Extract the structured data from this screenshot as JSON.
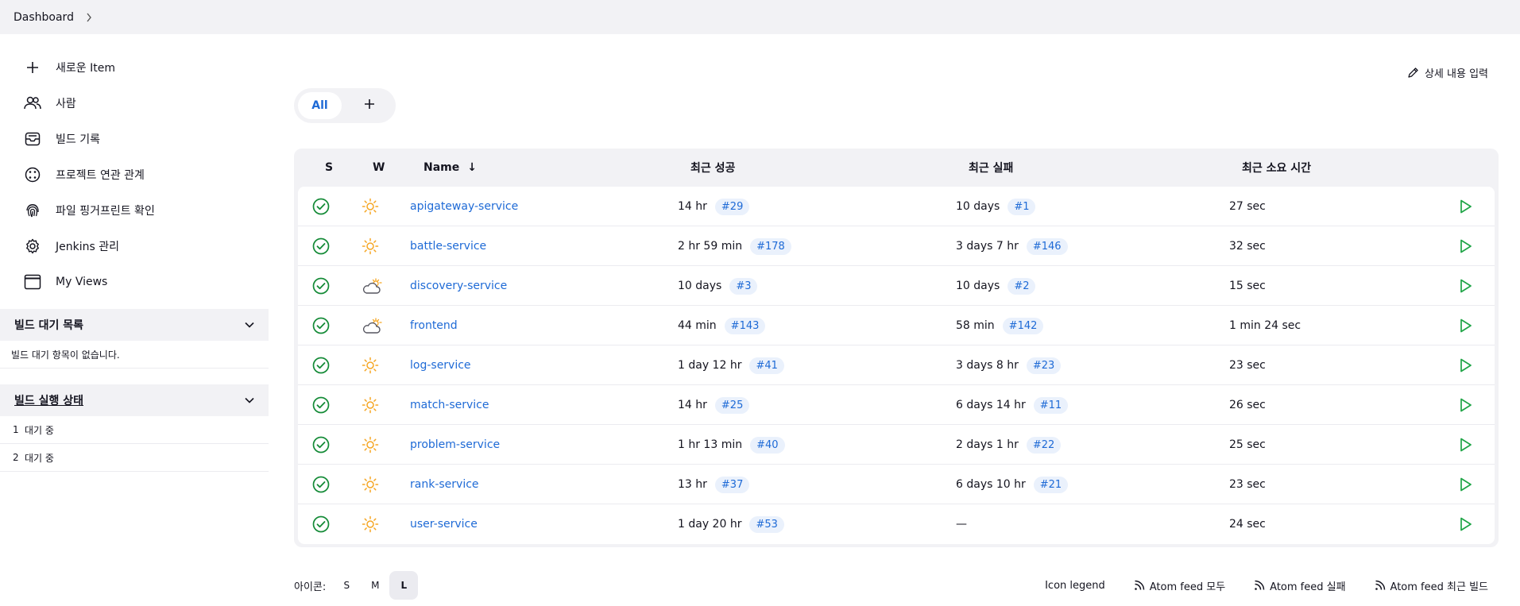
{
  "breadcrumb": {
    "root": "Dashboard"
  },
  "sidebar": {
    "items": [
      {
        "label": "새로운 Item",
        "icon": "plus-icon"
      },
      {
        "label": "사람",
        "icon": "people-icon"
      },
      {
        "label": "빌드 기록",
        "icon": "inbox-icon"
      },
      {
        "label": "프로젝트 연관 관계",
        "icon": "relationship-icon"
      },
      {
        "label": "파일 핑거프린트 확인",
        "icon": "fingerprint-icon"
      },
      {
        "label": "Jenkins 관리",
        "icon": "gear-icon"
      },
      {
        "label": "My Views",
        "icon": "window-icon"
      }
    ]
  },
  "build_queue": {
    "title": "빌드 대기 목록",
    "empty": "빌드 대기 항목이 없습니다."
  },
  "executors": {
    "title": "빌드 실행 상태",
    "rows": [
      {
        "num": "1",
        "state": "대기 중"
      },
      {
        "num": "2",
        "state": "대기 중"
      }
    ]
  },
  "main": {
    "description_button": "상세 내용 입력",
    "tabs": {
      "all": "All"
    }
  },
  "table": {
    "headers": {
      "s": "S",
      "w": "W",
      "name": "Name",
      "sort": "↓",
      "last_success": "최근 성공",
      "last_failure": "최근 실패",
      "last_duration": "최근 소요 시간"
    },
    "rows": [
      {
        "name": "apigateway-service",
        "weather": "sunny",
        "success_time": "14 hr",
        "success_build": "#29",
        "failure_time": "10 days",
        "failure_build": "#1",
        "duration": "27 sec"
      },
      {
        "name": "battle-service",
        "weather": "sunny",
        "success_time": "2 hr 59 min",
        "success_build": "#178",
        "failure_time": "3 days 7 hr",
        "failure_build": "#146",
        "duration": "32 sec"
      },
      {
        "name": "discovery-service",
        "weather": "partly-cloudy",
        "success_time": "10 days",
        "success_build": "#3",
        "failure_time": "10 days",
        "failure_build": "#2",
        "duration": "15 sec"
      },
      {
        "name": "frontend",
        "weather": "partly-cloudy",
        "success_time": "44 min",
        "success_build": "#143",
        "failure_time": "58 min",
        "failure_build": "#142",
        "duration": "1 min 24 sec"
      },
      {
        "name": "log-service",
        "weather": "sunny",
        "success_time": "1 day 12 hr",
        "success_build": "#41",
        "failure_time": "3 days 8 hr",
        "failure_build": "#23",
        "duration": "23 sec"
      },
      {
        "name": "match-service",
        "weather": "sunny",
        "success_time": "14 hr",
        "success_build": "#25",
        "failure_time": "6 days 14 hr",
        "failure_build": "#11",
        "duration": "26 sec"
      },
      {
        "name": "problem-service",
        "weather": "sunny",
        "success_time": "1 hr 13 min",
        "success_build": "#40",
        "failure_time": "2 days 1 hr",
        "failure_build": "#22",
        "duration": "25 sec"
      },
      {
        "name": "rank-service",
        "weather": "sunny",
        "success_time": "13 hr",
        "success_build": "#37",
        "failure_time": "6 days 10 hr",
        "failure_build": "#21",
        "duration": "23 sec"
      },
      {
        "name": "user-service",
        "weather": "sunny",
        "success_time": "1 day 20 hr",
        "success_build": "#53",
        "failure_time": "—",
        "failure_build": "",
        "duration": "24 sec"
      }
    ]
  },
  "footer": {
    "icon_label": "아이콘:",
    "sizes": [
      "S",
      "M",
      "L"
    ],
    "active_size": "L",
    "icon_legend": "Icon legend",
    "feeds": [
      "Atom feed 모두",
      "Atom feed 실패",
      "Atom feed 최근 빌드"
    ]
  },
  "colors": {
    "link": "#1e6ad6",
    "success": "#138a36",
    "sun": "#f5a623",
    "run": "#1ea446"
  }
}
